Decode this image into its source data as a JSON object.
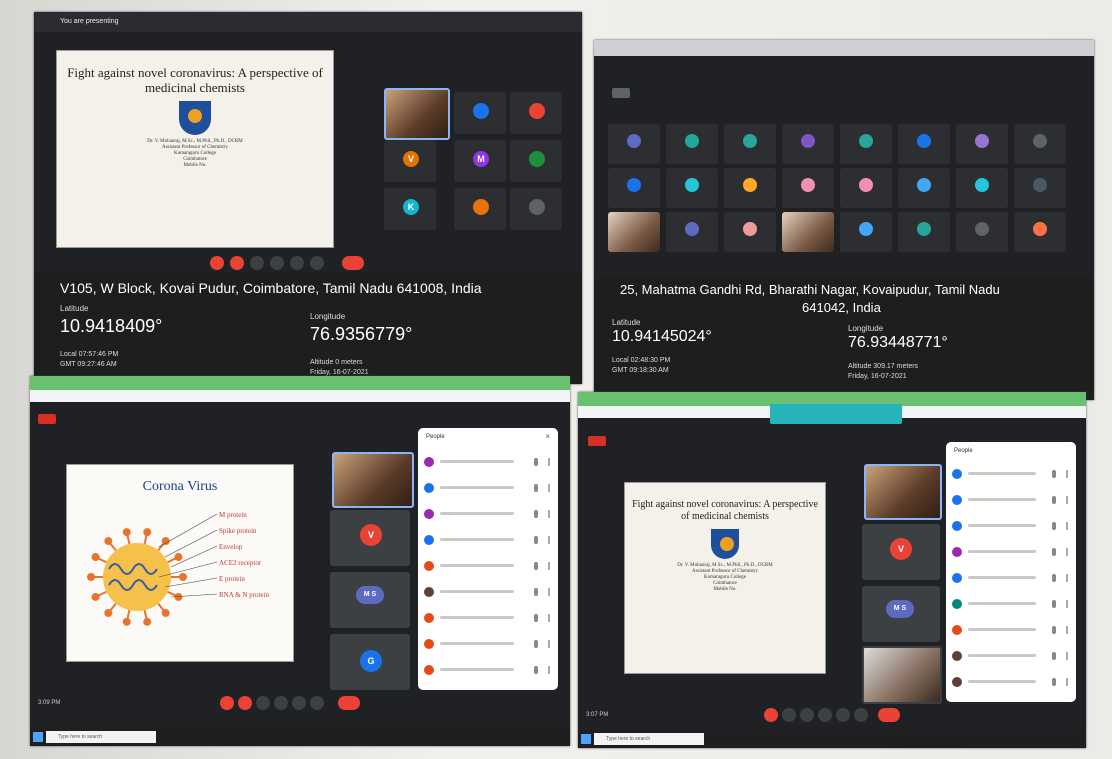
{
  "panel1": {
    "status": "You are presenting",
    "slide": {
      "title": "Fight against novel coronavirus: A perspective of medicinal chemists",
      "lines": [
        "Dr. V. Mohanraj, M.Sc., M.Phil., Ph.D., DCRM",
        "Assistant Professor of Chemistry",
        "Kumaraguru College",
        "Coimbatore",
        "Mobile No."
      ]
    },
    "tile_initials": [
      "",
      "",
      "V",
      "M",
      "",
      "K",
      "",
      ""
    ],
    "tile_colors": [
      "#1a73e8",
      "#ea4335",
      "#e37400",
      "#9334e6",
      "#1e8e3e",
      "#12b5cb",
      "#e8710a",
      "#5f6368"
    ],
    "geo": {
      "address": "V105, W Block, Kovai Pudur, Coimbatore, Tamil Nadu 641008, India",
      "latitude_label": "Latitude",
      "latitude": "10.9418409°",
      "longitude_label": "Longitude",
      "longitude": "76.9356779°",
      "local_time": "Local 07:57:46 PM",
      "gmt_time": "GMT 09:27:46 AM",
      "altitude": "Altitude 0 meters",
      "date": "Friday, 16-07-2021"
    }
  },
  "panel2": {
    "geo": {
      "address_line1": "25, Mahatma Gandhi Rd, Bharathi Nagar, Kovaipudur, Tamil Nadu",
      "address_line2": "641042, India",
      "latitude_label": "Latitude",
      "latitude": "10.94145024°",
      "longitude_label": "Longitude",
      "longitude": "76.93448771°",
      "local_time": "Local 02:48:30 PM",
      "gmt_time": "GMT 09:18:30 AM",
      "altitude": "Altitude 309.17 meters",
      "date": "Friday, 16-07-2021"
    },
    "grid_colors": [
      "#5c6bc0",
      "#26a69a",
      "#26a69a",
      "#7e57c2",
      "#26a69a",
      "#1a73e8",
      "#9575cd",
      "#5f6368",
      "#1a73e8",
      "#26c6da",
      "#ffa726",
      "#f48fb1",
      "#f48fb1",
      "#42a5f5",
      "#26c6da",
      "#455a64",
      "#8d6e63",
      "#5c6bc0",
      "#ef9a9a",
      "#8d6e63",
      "#42a5f5",
      "#26a69a",
      "#5f6368",
      "#ff7043"
    ]
  },
  "panel3": {
    "slide_title": "Corona Virus",
    "virus_labels": [
      "M protein",
      "Spike protein",
      "Envelop",
      "ACE2 receptor",
      "E protein",
      "RNA & N protein"
    ],
    "people_header": "People",
    "people_colors": [
      "#9c27b0",
      "#1a73e8",
      "#9c27b0",
      "#1a73e8",
      "#e64a19",
      "#5d4037",
      "#e64a19",
      "#e64a19",
      "#e64a19"
    ],
    "tile_initials": [
      "V",
      "M S",
      "G"
    ],
    "search_placeholder": "Type here to search",
    "time": "3:09 PM"
  },
  "panel4": {
    "slide": {
      "title": "Fight against novel coronavirus: A perspective of medicinal chemists",
      "lines": [
        "Dr. V. Mohanraj, M.Sc., M.Phil., Ph.D., DCRM",
        "Assistant Professor of Chemistry",
        "Kumaraguru College",
        "Coimbatore",
        "Mobile No."
      ]
    },
    "people_header": "People",
    "people_colors": [
      "#1a73e8",
      "#1a73e8",
      "#1a73e8",
      "#9c27b0",
      "#1a73e8",
      "#00897b",
      "#e64a19",
      "#5d4037",
      "#5d4037"
    ],
    "tile_initials": [
      "V",
      "M S"
    ],
    "search_placeholder": "Type here to search",
    "time": "3:07 PM"
  }
}
